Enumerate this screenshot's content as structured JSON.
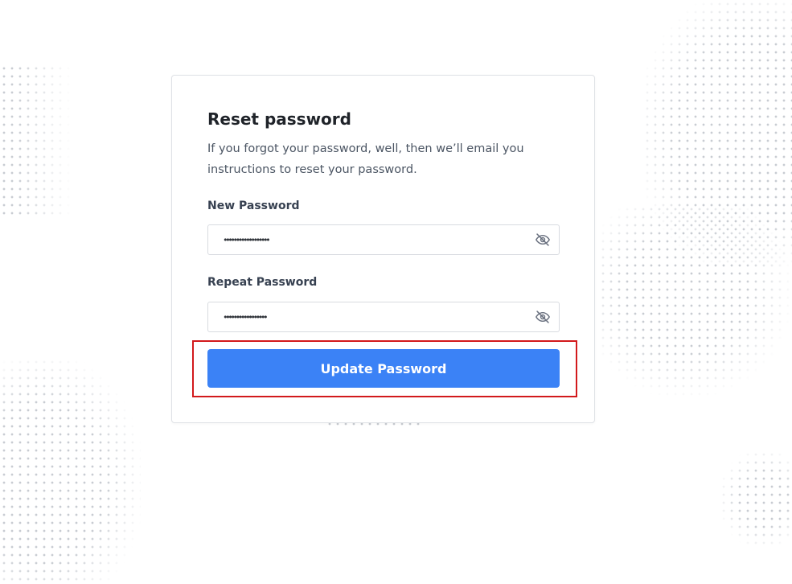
{
  "card": {
    "title": "Reset password",
    "subtitle": "If you forgot your password, well, then we’ll email you instructions to reset your password."
  },
  "form": {
    "new_password": {
      "label": "New Password",
      "value": "••••••••••••••••••",
      "toggle_icon": "eye-off-icon"
    },
    "repeat_password": {
      "label": "Repeat Password",
      "value": "•••••••••••••••••",
      "toggle_icon": "eye-off-icon"
    },
    "submit_label": "Update Password"
  },
  "colors": {
    "primary": "#3b82f6",
    "highlight": "#d2191c"
  }
}
